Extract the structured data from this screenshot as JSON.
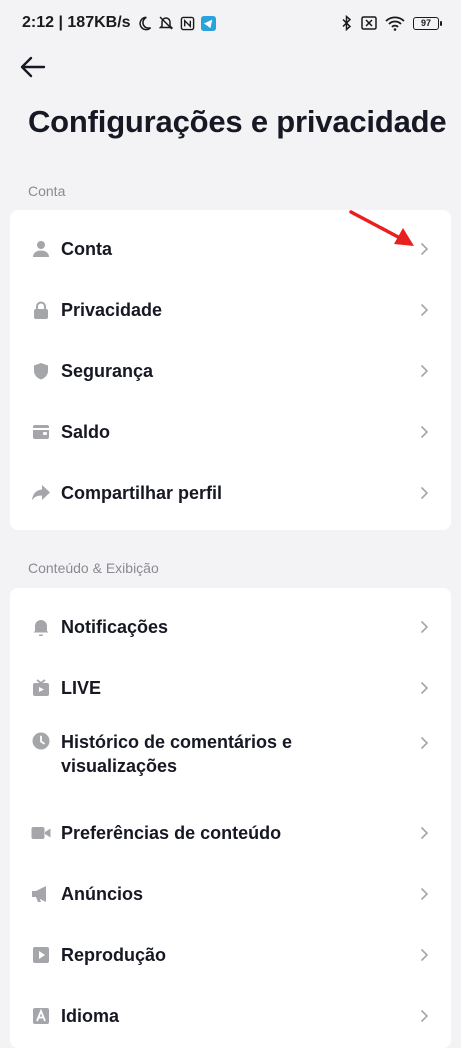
{
  "status_bar": {
    "time_speed": "2:12 | 187KB/s",
    "battery": "97"
  },
  "header": {
    "title": "Configurações e privacidade"
  },
  "sections": [
    {
      "label": "Conta",
      "items": [
        {
          "label": "Conta",
          "icon": "person-icon"
        },
        {
          "label": "Privacidade",
          "icon": "lock-icon"
        },
        {
          "label": "Segurança",
          "icon": "shield-icon"
        },
        {
          "label": "Saldo",
          "icon": "wallet-icon"
        },
        {
          "label": "Compartilhar perfil",
          "icon": "share-icon"
        }
      ]
    },
    {
      "label": "Conteúdo & Exibição",
      "items": [
        {
          "label": "Notificações",
          "icon": "bell-icon"
        },
        {
          "label": "LIVE",
          "icon": "tv-icon"
        },
        {
          "label": "Histórico de comentários e visualizações",
          "icon": "clock-icon"
        },
        {
          "label": "Preferências de conteúdo",
          "icon": "video-camera-icon"
        },
        {
          "label": "Anúncios",
          "icon": "megaphone-icon"
        },
        {
          "label": "Reprodução",
          "icon": "play-icon"
        },
        {
          "label": "Idioma",
          "icon": "language-icon"
        }
      ]
    }
  ],
  "colors": {
    "background": "#f3f3f5",
    "card": "#ffffff",
    "text": "#161823",
    "muted": "#8a8b91",
    "icon": "#a5a6aa",
    "annotation_arrow": "#e8201e"
  }
}
